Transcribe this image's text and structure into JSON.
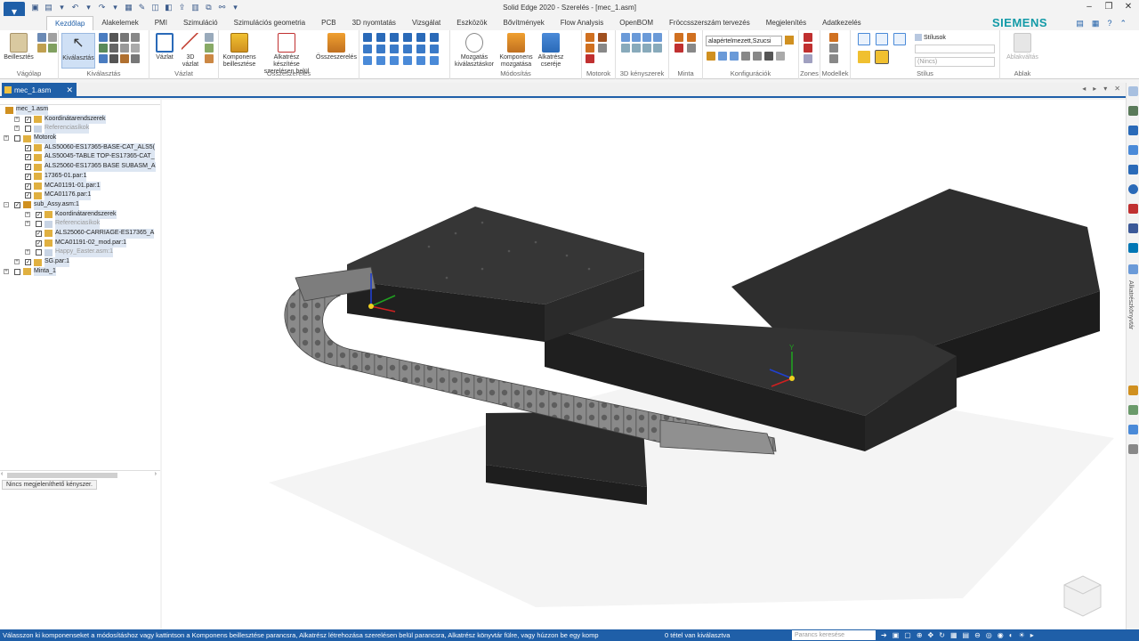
{
  "window": {
    "title": "Solid Edge 2020 - Szerelés - [mec_1.asm]",
    "brand": "SIEMENS"
  },
  "ribbon": {
    "tabs": [
      "Kezdőlap",
      "Alakelemek",
      "PMI",
      "Szimuláció",
      "Szimulációs geometria",
      "PCB",
      "3D nyomtatás",
      "Vizsgálat",
      "Eszközök",
      "Bővítmények",
      "Flow Analysis",
      "OpenBOM",
      "Fröccsszerszám tervezés",
      "Megjelenítés",
      "Adatkezelés"
    ],
    "active_tab": "Kezdőlap",
    "groups": {
      "vagolap": {
        "label": "Vágólap",
        "paste": "Beillesztés"
      },
      "kivalasztas": {
        "label": "Kiválasztás",
        "select": "Kiválasztás"
      },
      "vazlat": {
        "label": "Vázlat",
        "sketch": "Vázlat",
        "sketch3d_top": "3D",
        "sketch3d_bottom": "vázlat"
      },
      "osszeszereles": {
        "label": "Összeszerelés",
        "insert_comp_top": "Komponens",
        "insert_comp_bottom": "beillesztése",
        "create_part_top": "Alkatrész készítése",
        "create_part_bottom": "szerelésen belül",
        "assemble": "Összeszerelés"
      },
      "modositas": {
        "label": "Módosítás",
        "move_sel_top": "Mozgatás",
        "move_sel_bottom": "kiválasztáskor",
        "move_comp_top": "Komponens",
        "move_comp_bottom": "mozgatása",
        "replace_top": "Alkatrész",
        "replace_bottom": "cseréje"
      },
      "motorok": {
        "label": "Motorok"
      },
      "kenyszerek3d": {
        "label": "3D kényszerek"
      },
      "minta": {
        "label": "Minta"
      },
      "konfiguraciok": {
        "label": "Konfigurációk",
        "config_value": "alapértelmezett,Szucsi"
      },
      "zones": {
        "label": "Zones"
      },
      "modellek": {
        "label": "Modellek"
      },
      "stilus": {
        "label": "Stílus",
        "styles": "Stílusok",
        "none": "(Nincs)"
      },
      "ablak": {
        "label": "Ablak",
        "switch": "Ablakváltás"
      }
    }
  },
  "doc_tab": {
    "name": "mec_1.asm"
  },
  "pathfinder": {
    "rows": [
      {
        "label": "mec_1.asm",
        "indent": 0,
        "exp": "",
        "chk": false,
        "hl": true,
        "dim": false
      },
      {
        "label": "Koordinátarendszerek",
        "indent": 1,
        "exp": "+",
        "chk": true,
        "hl": true,
        "dim": false
      },
      {
        "label": "Referenciasíkok",
        "indent": 1,
        "exp": "+",
        "chk": false,
        "hl": true,
        "dim": true
      },
      {
        "label": "Motorok",
        "indent": 0,
        "exp": "+",
        "chk": false,
        "hl": true,
        "dim": false
      },
      {
        "label": "ALS50060-ES17365-BASE-CAT_ALS5(",
        "indent": 1,
        "exp": "",
        "chk": true,
        "hl": true,
        "dim": false
      },
      {
        "label": "ALS50045-TABLE TOP-ES17365-CAT_",
        "indent": 1,
        "exp": "",
        "chk": true,
        "hl": true,
        "dim": false
      },
      {
        "label": "ALS25060-ES17365 BASE SUBASM_A",
        "indent": 1,
        "exp": "",
        "chk": true,
        "hl": true,
        "dim": false
      },
      {
        "label": "17365-01.par:1",
        "indent": 1,
        "exp": "",
        "chk": true,
        "hl": true,
        "dim": false
      },
      {
        "label": "MCA01191-01.par:1",
        "indent": 1,
        "exp": "",
        "chk": true,
        "hl": true,
        "dim": false
      },
      {
        "label": "MCA01176.par:1",
        "indent": 1,
        "exp": "",
        "chk": true,
        "hl": true,
        "dim": false
      },
      {
        "label": "sub_Assy.asm:1",
        "indent": 0,
        "exp": "-",
        "chk": true,
        "hl": true,
        "dim": false
      },
      {
        "label": "Koordinátarendszerek",
        "indent": 2,
        "exp": "+",
        "chk": true,
        "hl": true,
        "dim": false
      },
      {
        "label": "Referenciasíkok",
        "indent": 2,
        "exp": "+",
        "chk": false,
        "hl": true,
        "dim": true
      },
      {
        "label": "ALS25060-CARRIAGE-ES17365_A",
        "indent": 2,
        "exp": "",
        "chk": true,
        "hl": true,
        "dim": false
      },
      {
        "label": "MCA01191-02_mod.par:1",
        "indent": 2,
        "exp": "",
        "chk": true,
        "hl": true,
        "dim": false
      },
      {
        "label": "Happy_Easter.asm:1",
        "indent": 2,
        "exp": "+",
        "chk": false,
        "hl": true,
        "dim": true
      },
      {
        "label": "SG.par:1",
        "indent": 1,
        "exp": "+",
        "chk": true,
        "hl": true,
        "dim": false
      },
      {
        "label": "Minta_1",
        "indent": 0,
        "exp": "+",
        "chk": false,
        "hl": true,
        "dim": false
      }
    ],
    "message": "Nincs megjeleníthető kényszer."
  },
  "rightbar": {
    "label": "Alkatrészkönyvtár"
  },
  "statusbar": {
    "message": "Válasszon ki komponenseket a módosításhoz vagy kattintson a Komponens beillesztése parancsra, Alkatrész létrehozása szerelésen belül parancsra, Alkatrész könyvtár fülre, vagy húzzon be egy komp",
    "selection": "0 tétel van kiválasztva",
    "search_placeholder": "Parancs keresése"
  },
  "viewport": {
    "axis_y": "Y"
  },
  "colors": {
    "accent": "#1f5fa8",
    "brand": "#129aa7",
    "part": "#2b2b2b",
    "chain": "#7a7a7a"
  }
}
